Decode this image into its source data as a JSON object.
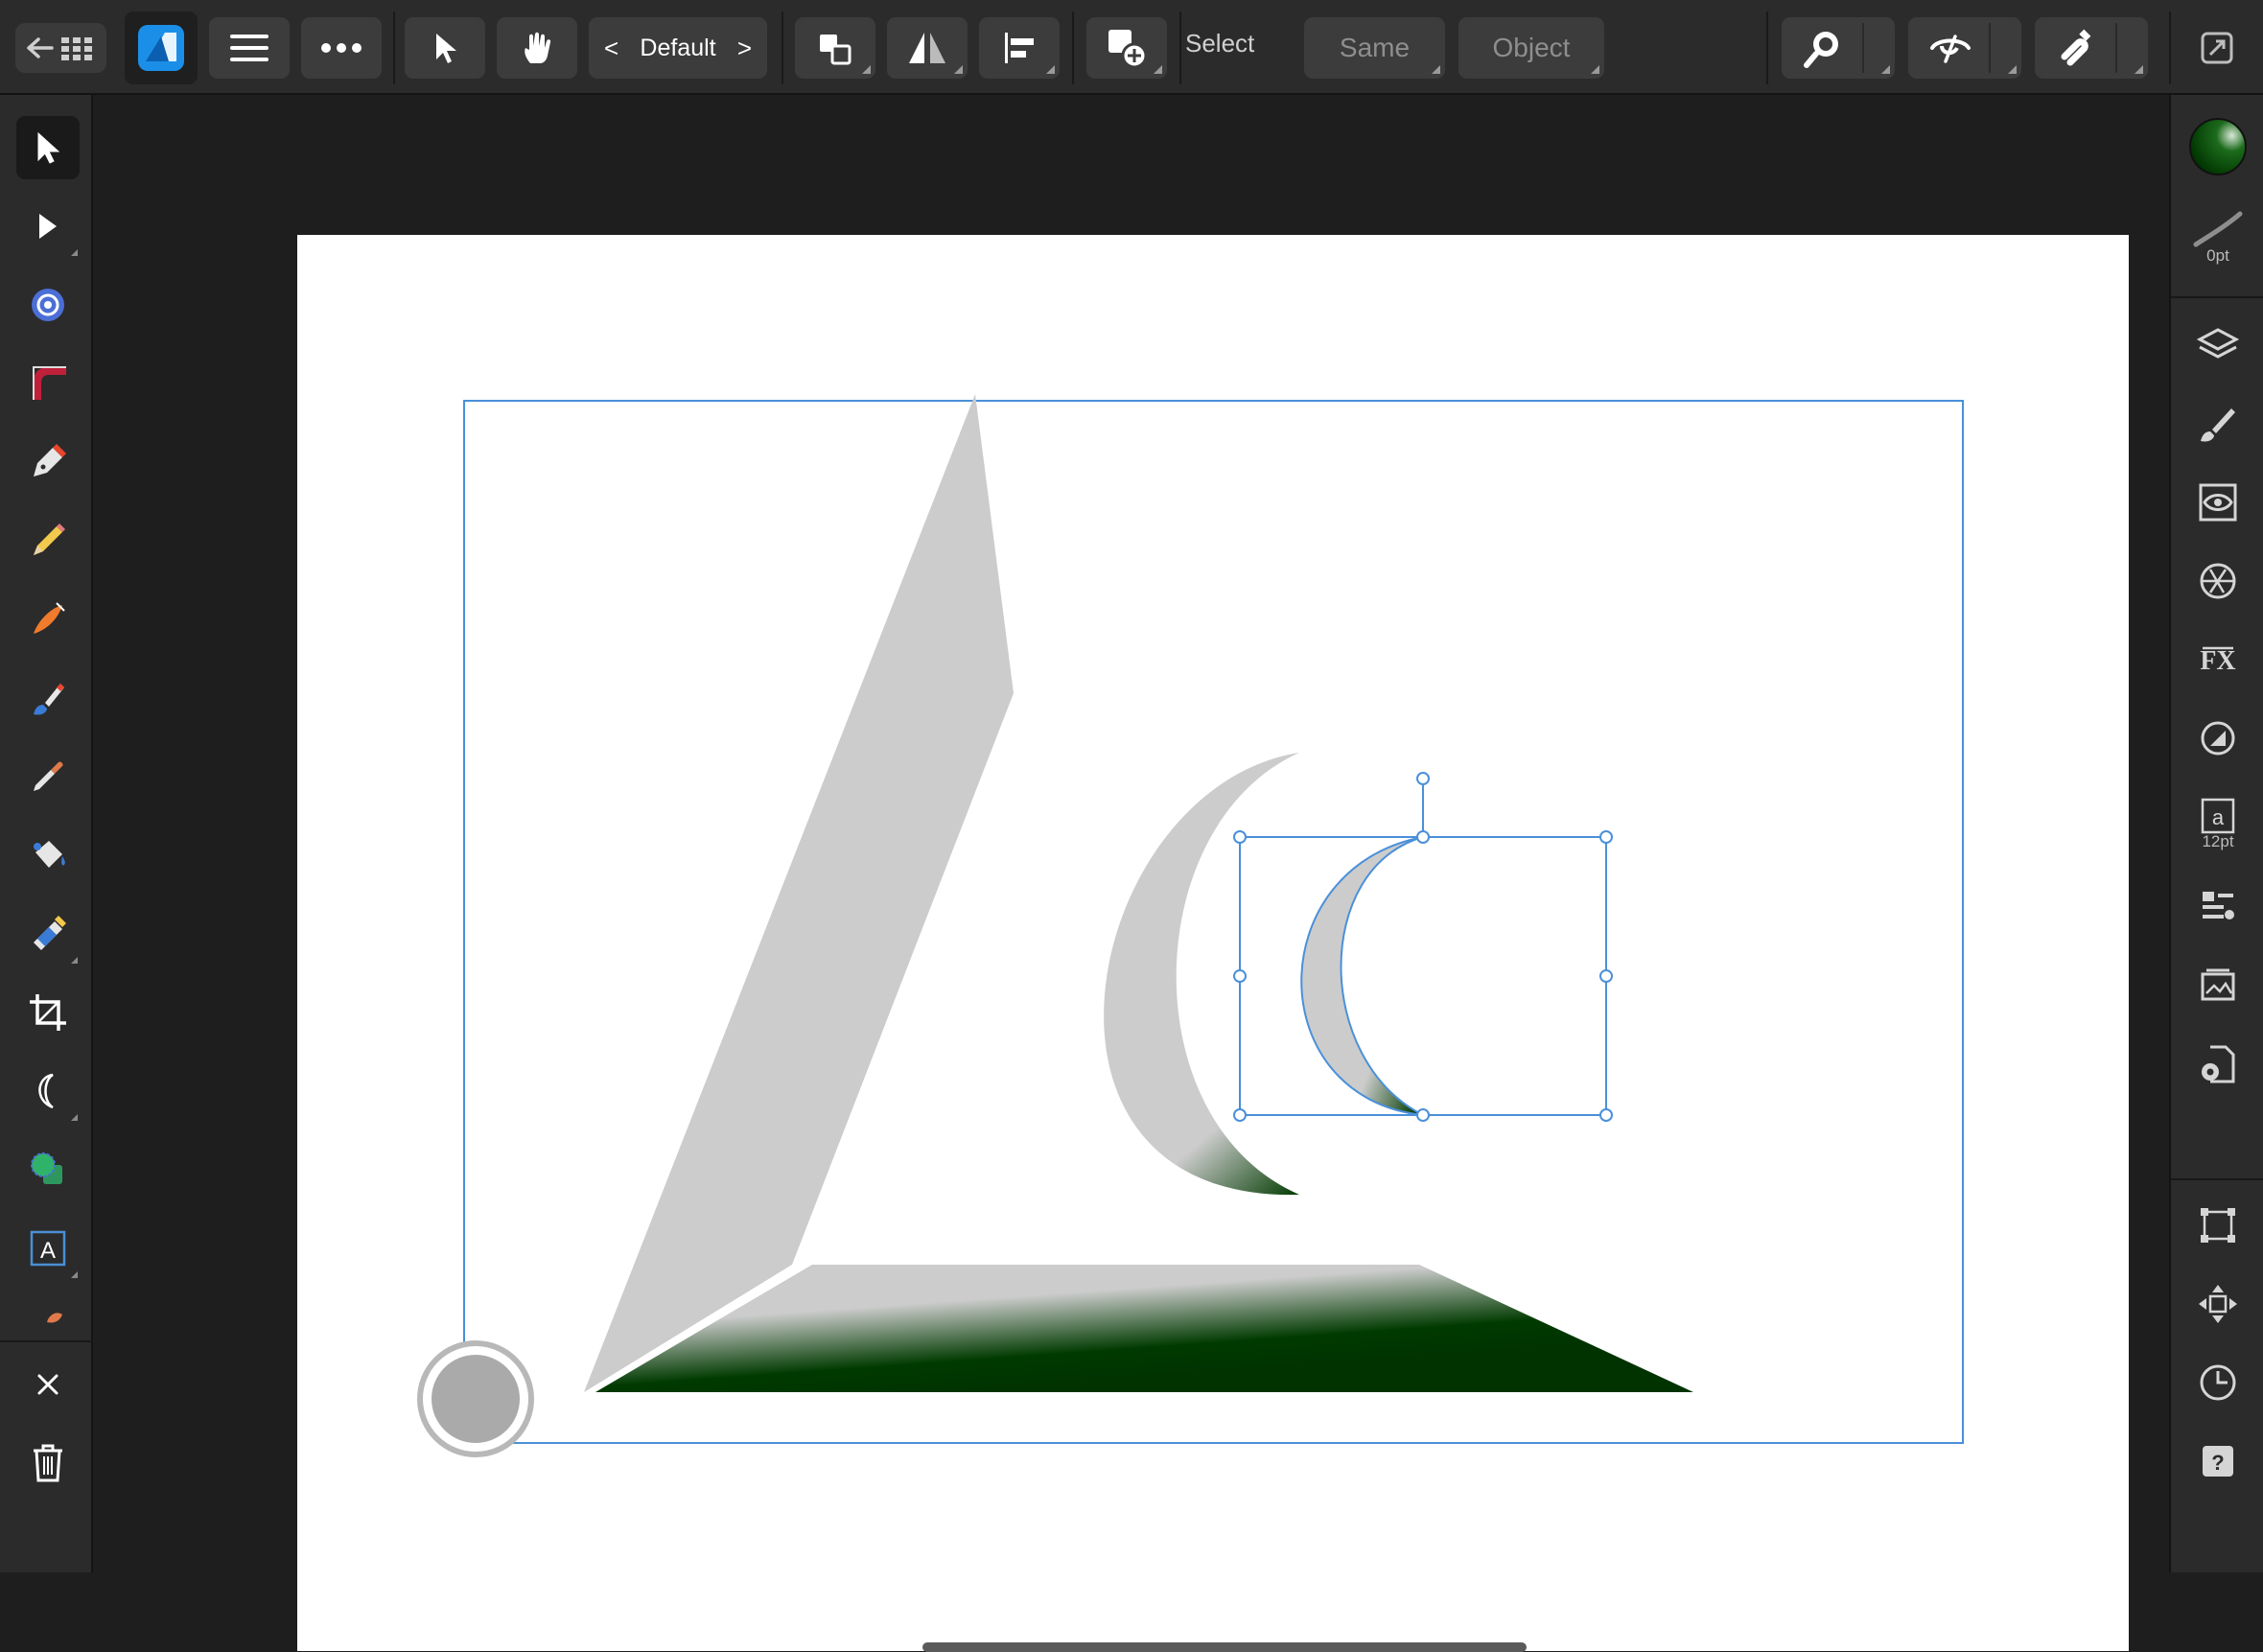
{
  "toolbar": {
    "persona_prev": "<",
    "persona_name": "Default",
    "persona_next": ">",
    "select_label": "Select",
    "same_label": "Same",
    "object_label": "Object"
  },
  "left_tools": [
    {
      "name": "move-tool",
      "icon": "arrow-cursor-icon"
    },
    {
      "name": "node-tool",
      "icon": "node-arrow-icon"
    },
    {
      "name": "point-transform-tool",
      "icon": "target-icon"
    },
    {
      "name": "corner-tool",
      "icon": "corner-icon"
    },
    {
      "name": "pen-tool",
      "icon": "pen-icon"
    },
    {
      "name": "pencil-tool",
      "icon": "pencil-icon"
    },
    {
      "name": "vector-brush-tool",
      "icon": "vector-brush-icon"
    },
    {
      "name": "paint-brush-tool",
      "icon": "paint-brush-icon"
    },
    {
      "name": "eyedropper-tool",
      "icon": "eyedropper-icon"
    },
    {
      "name": "fill-tool",
      "icon": "fill-bucket-icon"
    },
    {
      "name": "transparency-tool",
      "icon": "transparency-icon"
    },
    {
      "name": "crop-tool",
      "icon": "crop-icon"
    },
    {
      "name": "crescent-tool",
      "icon": "crescent-icon"
    },
    {
      "name": "shape-builder-tool",
      "icon": "shape-builder-icon"
    },
    {
      "name": "artistic-text-tool",
      "icon": "text-frame-icon"
    }
  ],
  "right_studio": {
    "stroke_width": "0pt",
    "text_size": "12pt"
  },
  "colors": {
    "ui_background": "#2b2b2b",
    "canvas_background": "#1e1e1e",
    "selection_blue": "#4a90d9",
    "fill_green": "#003a00",
    "fill_grey": "#cccccc",
    "page_white": "#ffffff"
  }
}
